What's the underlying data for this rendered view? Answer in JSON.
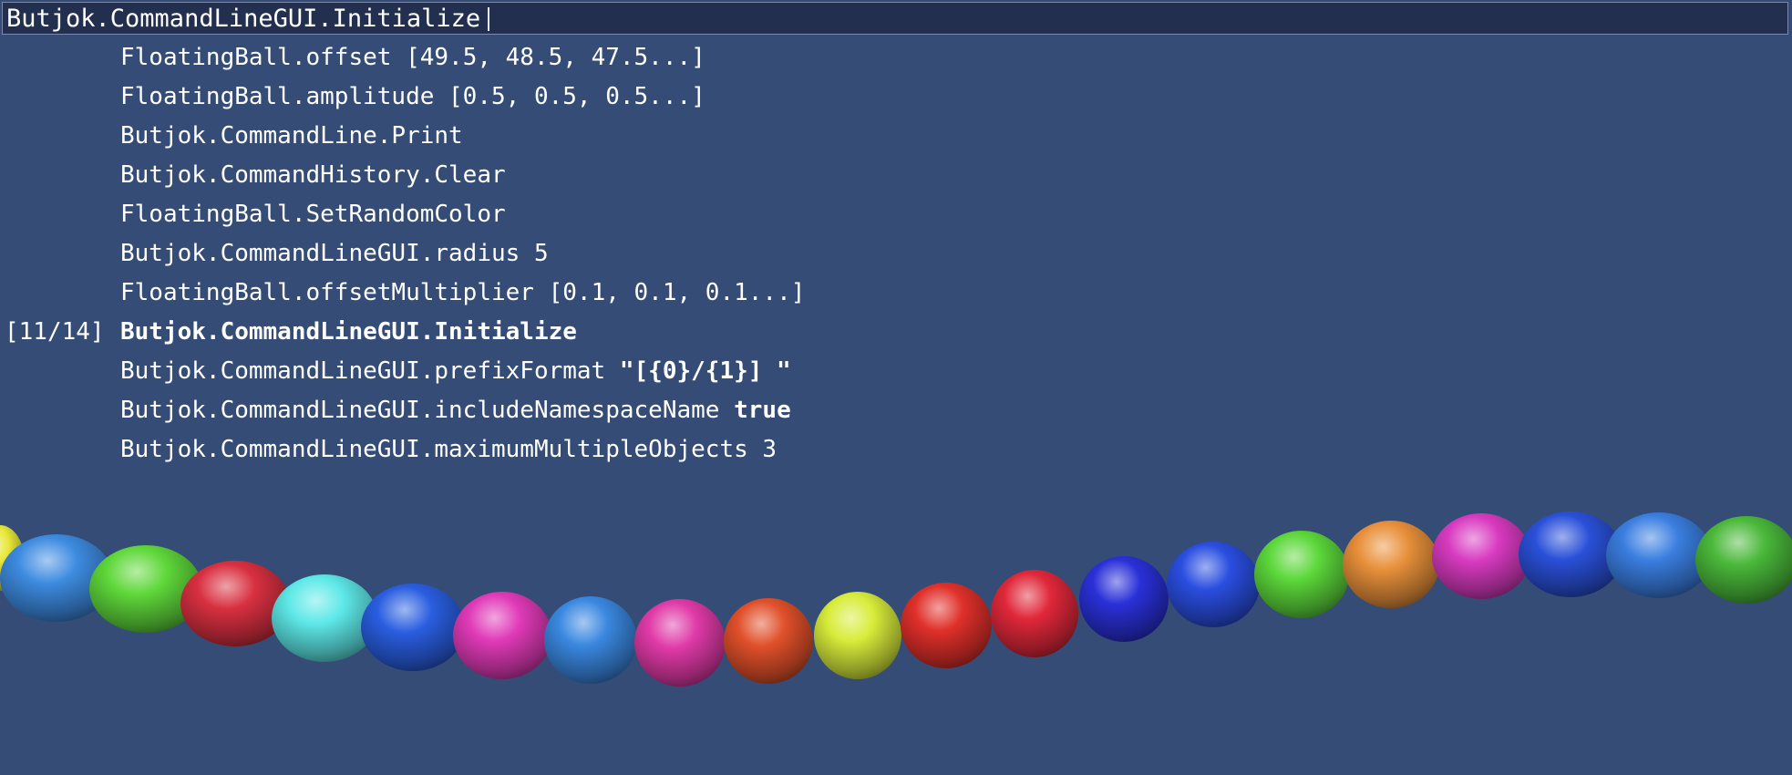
{
  "command_line": {
    "input_value": "Butjok.CommandLineGUI.Initialize"
  },
  "history": [
    {
      "prefix": "",
      "command": "FloatingBall.offset",
      "value": "[49.5, 48.5, 47.5...]",
      "value_bold": false,
      "selected": false
    },
    {
      "prefix": "",
      "command": "FloatingBall.amplitude",
      "value": "[0.5, 0.5, 0.5...]",
      "value_bold": false,
      "selected": false
    },
    {
      "prefix": "",
      "command": "Butjok.CommandLine.Print",
      "value": "",
      "value_bold": false,
      "selected": false
    },
    {
      "prefix": "",
      "command": "Butjok.CommandHistory.Clear",
      "value": "",
      "value_bold": false,
      "selected": false
    },
    {
      "prefix": "",
      "command": "FloatingBall.SetRandomColor",
      "value": "",
      "value_bold": false,
      "selected": false
    },
    {
      "prefix": "",
      "command": "Butjok.CommandLineGUI.radius",
      "value": "5",
      "value_bold": false,
      "selected": false
    },
    {
      "prefix": "",
      "command": "FloatingBall.offsetMultiplier",
      "value": "[0.1, 0.1, 0.1...]",
      "value_bold": false,
      "selected": false
    },
    {
      "prefix": "[11/14]",
      "command": "Butjok.CommandLineGUI.Initialize",
      "value": "",
      "value_bold": false,
      "selected": true
    },
    {
      "prefix": "",
      "command": "Butjok.CommandLineGUI.prefixFormat",
      "value": "\"[{0}/{1}] \"",
      "value_bold": true,
      "selected": false
    },
    {
      "prefix": "",
      "command": "Butjok.CommandLineGUI.includeNamespaceName",
      "value": "true",
      "value_bold": true,
      "selected": false
    },
    {
      "prefix": "",
      "command": "Butjok.CommandLineGUI.maximumMultipleObjects",
      "value": "3",
      "value_bold": false,
      "selected": false
    }
  ],
  "scene": {
    "background": "#344c76",
    "balls": [
      {
        "color": "#e8e83a"
      },
      {
        "color": "#3d8be0"
      },
      {
        "color": "#5fd83a"
      },
      {
        "color": "#d83040"
      },
      {
        "color": "#5ee8e8"
      },
      {
        "color": "#2a5ee0"
      },
      {
        "color": "#e03ab8"
      },
      {
        "color": "#3a88e0"
      },
      {
        "color": "#e03aa8"
      },
      {
        "color": "#e0502a"
      },
      {
        "color": "#d8ec3a"
      },
      {
        "color": "#e0302a"
      },
      {
        "color": "#e0283a"
      },
      {
        "color": "#2a30d8"
      },
      {
        "color": "#2a4ee0"
      },
      {
        "color": "#5cd83a"
      },
      {
        "color": "#e8903a"
      },
      {
        "color": "#d83ac0"
      },
      {
        "color": "#2a50d8"
      },
      {
        "color": "#3a7ee0"
      },
      {
        "color": "#4ab83a"
      }
    ]
  }
}
